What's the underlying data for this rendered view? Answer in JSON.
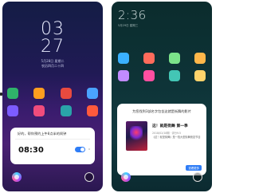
{
  "left": {
    "lock_hour": "03",
    "lock_minute": "27",
    "lock_date": "5月28日 星期二",
    "lock_date_sub": "农历四月二十四",
    "apps": [
      "",
      "",
      "",
      "",
      "",
      "",
      "",
      "",
      "",
      "",
      "",
      ""
    ],
    "app_colors": [
      "#2fb36a",
      "#ff9e1f",
      "#e94a3f",
      "#4aa3ff",
      "#7c5cff",
      "#f04c7c",
      "#2aa3a9",
      "#ff5a3c",
      "#1e90ff",
      "#fbbf24",
      "#34c759",
      "#ff7a59"
    ],
    "assistant_query": "好的，帮你预约上午8点半的闹钟",
    "alarm_time": "08:30",
    "alarm_enabled": true
  },
  "right": {
    "home_time": "2:36",
    "home_date": "5月29日 星期三",
    "assistant_query": "为您找到3部名字包含这就是街舞的影片",
    "movie_title": "这！就是街舞 第一季",
    "movie_meta": "2018/02/18期 · 评分9.5",
    "movie_desc": "《这！就是街舞》是一档大型街舞竞技节目",
    "more_label": "查看更多",
    "app_colors": [
      "#3ab0ff",
      "#ff6b5b",
      "#7be38a",
      "#ffb74a",
      "#c18bff",
      "#ff4fa0",
      "#43c6b5",
      "#ffd36b"
    ]
  }
}
